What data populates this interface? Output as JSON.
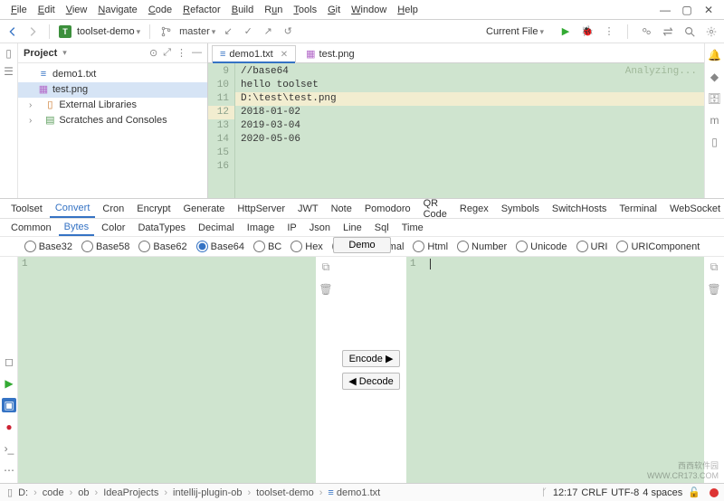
{
  "window": {
    "menu": [
      "File",
      "Edit",
      "View",
      "Navigate",
      "Code",
      "Refactor",
      "Build",
      "Run",
      "Tools",
      "Git",
      "Window",
      "Help"
    ],
    "controls": {
      "minimize": "—",
      "maximize": "▢",
      "close": "✕"
    }
  },
  "toolbar": {
    "project_badge": "T",
    "project_name": "toolset-demo",
    "vcs_branch": "master",
    "run_config": "Current File"
  },
  "project_tool": {
    "title": "Project",
    "tree": [
      {
        "label": "demo1.txt",
        "icon": "txt",
        "selected": false
      },
      {
        "label": "test.png",
        "icon": "img",
        "selected": true
      },
      {
        "label": "External Libraries",
        "icon": "lib",
        "caret": true
      },
      {
        "label": "Scratches and Consoles",
        "icon": "scratch",
        "caret": true
      }
    ]
  },
  "editor": {
    "tabs": [
      {
        "label": "demo1.txt",
        "icon": "txt",
        "active": true
      },
      {
        "label": "test.png",
        "icon": "img",
        "active": false
      }
    ],
    "status_hint": "Analyzing...",
    "lines": [
      {
        "num": 9,
        "text": "//base64"
      },
      {
        "num": 10,
        "text": "hello toolset"
      },
      {
        "num": 11,
        "text": ""
      },
      {
        "num": 12,
        "text": "D:\\test\\test.png",
        "hl": true
      },
      {
        "num": 13,
        "text": ""
      },
      {
        "num": 14,
        "text": "2018-01-02"
      },
      {
        "num": 15,
        "text": "2019-03-04"
      },
      {
        "num": 16,
        "text": "2020-05-06"
      }
    ]
  },
  "toolset": {
    "tabs": [
      "Toolset",
      "Convert",
      "Cron",
      "Encrypt",
      "Generate",
      "HttpServer",
      "JWT",
      "Note",
      "Pomodoro",
      "QR Code",
      "Regex",
      "Symbols",
      "SwitchHosts",
      "Terminal",
      "WebSocket"
    ],
    "active_tab": "Convert",
    "sub_tabs": [
      "Common",
      "Bytes",
      "Color",
      "DataTypes",
      "Decimal",
      "Image",
      "IP",
      "Json",
      "Line",
      "Sql",
      "Time"
    ],
    "active_sub": "Bytes",
    "radios": [
      "Base32",
      "Base58",
      "Base62",
      "Base64",
      "BC",
      "Hex",
      "Hexadecimal",
      "Html",
      "Number",
      "Unicode",
      "URI",
      "URIComponent"
    ],
    "selected_radio": "Base64",
    "demo_label": "Demo",
    "encode_label": "Encode ▶",
    "decode_label": "◀ Decode",
    "left_line": "1",
    "right_line": "1"
  },
  "statusbar": {
    "crumbs": [
      "D:",
      "code",
      "ob",
      "IdeaProjects",
      "intellij-plugin-ob",
      "toolset-demo",
      "demo1.txt"
    ],
    "line_col": "12:17",
    "eol": "CRLF",
    "encoding": "UTF-8",
    "indent": "4 spaces"
  },
  "watermark": {
    "brand": "西西软件园",
    "url": "WWW.CR173.COM"
  }
}
